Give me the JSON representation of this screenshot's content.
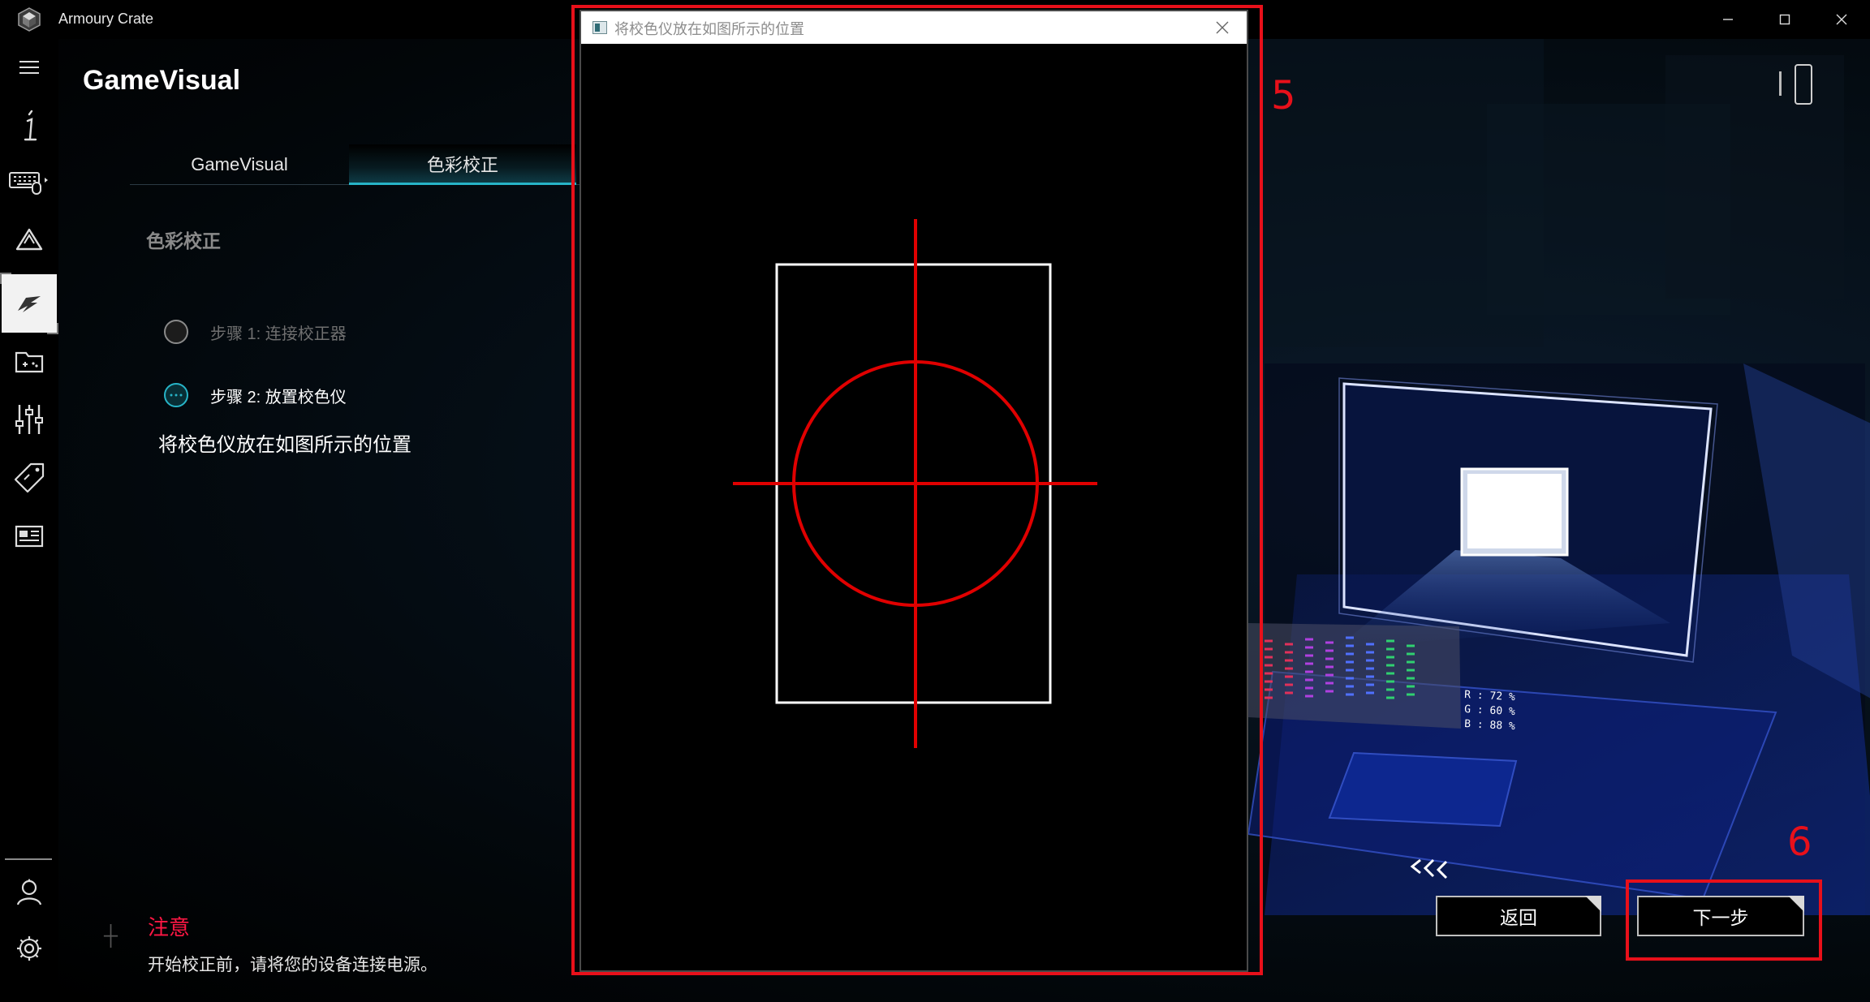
{
  "app": {
    "title": "Armoury Crate"
  },
  "page": {
    "title": "GameVisual"
  },
  "tabs": [
    {
      "label": "GameVisual",
      "active": false
    },
    {
      "label": "色彩校正",
      "active": true
    }
  ],
  "calibration": {
    "section_title": "色彩校正",
    "steps": [
      {
        "label": "步骤 1:  连接校正器",
        "state": "completed"
      },
      {
        "label": "步骤 2:  放置校色仪",
        "state": "current"
      }
    ],
    "instruction": "将校色仪放在如图所示的位置"
  },
  "notice": {
    "title": "注意",
    "text": "开始校正前，请将您的设备连接电源。"
  },
  "buttons": {
    "back": "返回",
    "next": "下一步"
  },
  "calibration_window": {
    "title": "将校色仪放在如图所示的位置"
  },
  "illustration": {
    "readout_r": "R : 72 %",
    "readout_g": "G : 60 %",
    "readout_b": "B : 88 %"
  },
  "annotations": {
    "box_5": "5",
    "box_6": "6"
  },
  "sidebar_icons": [
    "menu-icon",
    "info-icon",
    "keyboard-icon",
    "aura-icon",
    "gamevisual-icon",
    "game-library-icon",
    "scenario-profiles-icon",
    "deals-icon",
    "news-icon",
    "user-center-icon",
    "settings-icon"
  ],
  "colors": {
    "accent": "#27b4c7",
    "warning": "#ff1744",
    "annotation": "#e8101a",
    "crosshair": "#e00000"
  }
}
